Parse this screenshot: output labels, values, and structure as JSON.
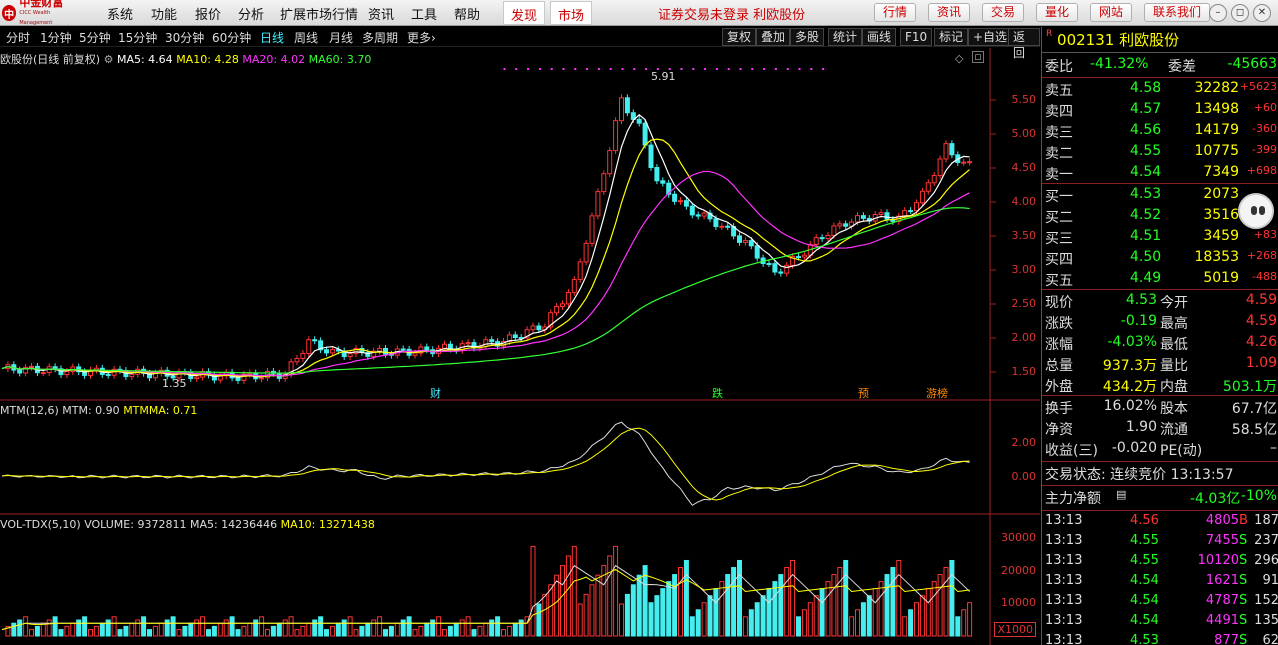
{
  "app": {
    "logo_text": "中金财富",
    "logo_sub": "CICC Wealth Management",
    "menus": [
      "系统",
      "功能",
      "报价",
      "分析",
      "扩展市场行情",
      "资讯",
      "工具",
      "帮助"
    ],
    "highlight_tabs": [
      "发现",
      "市场"
    ],
    "notice": "证券交易未登录  利欧股份",
    "right_buttons": [
      "行情",
      "资讯",
      "交易",
      "量化",
      "网站",
      "联系我们"
    ],
    "window_buttons": [
      "–",
      "◻",
      "✕"
    ]
  },
  "toolbar": {
    "periods": [
      "分时",
      "1分钟",
      "5分钟",
      "15分钟",
      "30分钟",
      "60分钟",
      "日线",
      "周线",
      "月线",
      "多周期",
      "更多"
    ],
    "active_period": "日线",
    "more_arrow": "›",
    "tools": [
      "复权",
      "叠加",
      "多股",
      "统计",
      "画线",
      "F10",
      "标记",
      "+自选",
      "返回"
    ]
  },
  "price_panel": {
    "legend_title": "欧股份(日线 前复权)",
    "ma": [
      {
        "label": "MA5: 4.64",
        "color": "#ffffff"
      },
      {
        "label": "MA10: 4.28",
        "color": "#ffff00"
      },
      {
        "label": "MA20: 4.02",
        "color": "#ff33ff"
      },
      {
        "label": "MA60: 3.70",
        "color": "#33ff33"
      }
    ],
    "high_label": "5.91",
    "low_label": "1.35",
    "y_ticks": [
      "5.50",
      "5.00",
      "4.50",
      "4.00",
      "3.50",
      "3.00",
      "2.50",
      "2.00",
      "1.50"
    ],
    "markers": [
      {
        "text": "财",
        "color": "#4ef"
      },
      {
        "text": "跌",
        "color": "#2f2"
      },
      {
        "text": "预",
        "color": "#ff8c00"
      },
      {
        "text": "游榜",
        "color": "#ff8c00"
      }
    ]
  },
  "mtm_panel": {
    "title": "MTM(12,6)",
    "mtm": "MTM: 0.90",
    "mtmma": "MTMMA: 0.71",
    "y_ticks": [
      "2.00",
      "0.00"
    ]
  },
  "vol_panel": {
    "title": "VOL-TDX(5,10)",
    "volume": "VOLUME: 9372811",
    "ma5": "MA5: 14236446",
    "ma10": "MA10: 13271438",
    "y_ticks": [
      "30000",
      "20000",
      "10000"
    ],
    "unit": "X1000"
  },
  "quote": {
    "code": "002131",
    "name": "利欧股份",
    "code_mark": "R",
    "weibi_label": "委比",
    "weibi": "-41.32%",
    "weicha_label": "委差",
    "weicha": "-45663",
    "sells": [
      {
        "label": "卖五",
        "price": "4.58",
        "vol": "32282",
        "chg": "+5623"
      },
      {
        "label": "卖四",
        "price": "4.57",
        "vol": "13498",
        "chg": "+60"
      },
      {
        "label": "卖三",
        "price": "4.56",
        "vol": "14179",
        "chg": "-360"
      },
      {
        "label": "卖二",
        "price": "4.55",
        "vol": "10775",
        "chg": "-399"
      },
      {
        "label": "卖一",
        "price": "4.54",
        "vol": "7349",
        "chg": "+698"
      }
    ],
    "buys": [
      {
        "label": "买一",
        "price": "4.53",
        "vol": "2073",
        "chg": ""
      },
      {
        "label": "买二",
        "price": "4.52",
        "vol": "3516",
        "chg": ""
      },
      {
        "label": "买三",
        "price": "4.51",
        "vol": "3459",
        "chg": "+83"
      },
      {
        "label": "买四",
        "price": "4.50",
        "vol": "18353",
        "chg": "+268"
      },
      {
        "label": "买五",
        "price": "4.49",
        "vol": "5019",
        "chg": "-488"
      }
    ],
    "stats": [
      {
        "l1": "现价",
        "v1": "4.53",
        "l2": "今开",
        "v2": "4.59"
      },
      {
        "l1": "涨跌",
        "v1": "-0.19",
        "l2": "最高",
        "v2": "4.59"
      },
      {
        "l1": "涨幅",
        "v1": "-4.03%",
        "l2": "最低",
        "v2": "4.26"
      },
      {
        "l1": "总量",
        "v1": "937.3万",
        "l2": "量比",
        "v2": "1.09"
      },
      {
        "l1": "外盘",
        "v1": "434.2万",
        "l2": "内盘",
        "v2": "503.1万"
      }
    ],
    "stats2": [
      {
        "l1": "换手",
        "v1": "16.02%",
        "l2": "股本",
        "v2": "67.7亿"
      },
      {
        "l1": "净资",
        "v1": "1.90",
        "l2": "流通",
        "v2": "58.5亿"
      },
      {
        "l1": "收益(三)",
        "v1": "-0.020",
        "l2": "PE(动)",
        "v2": "–"
      }
    ],
    "trade_status": "交易状态: 连续竞价 13:13:57",
    "main_net_label": "主力净额",
    "main_net": "-4.03亿",
    "main_net_pct": "-10%",
    "ticks": [
      {
        "t": "13:13",
        "p": "4.56",
        "v": "4805",
        "s": "B",
        "n": "187"
      },
      {
        "t": "13:13",
        "p": "4.55",
        "v": "7455",
        "s": "S",
        "n": "237"
      },
      {
        "t": "13:13",
        "p": "4.55",
        "v": "10120",
        "s": "S",
        "n": "296"
      },
      {
        "t": "13:13",
        "p": "4.54",
        "v": "1621",
        "s": "S",
        "n": "91"
      },
      {
        "t": "13:13",
        "p": "4.54",
        "v": "4787",
        "s": "S",
        "n": "152"
      },
      {
        "t": "13:13",
        "p": "4.54",
        "v": "4491",
        "s": "S",
        "n": "135"
      },
      {
        "t": "13:13",
        "p": "4.53",
        "v": "877",
        "s": "S",
        "n": "62"
      }
    ]
  },
  "colors": {
    "up": "#ff3333",
    "down": "#44eeee",
    "ma5": "#ffffff",
    "ma10": "#ffff00",
    "ma20": "#ff33ff",
    "ma60": "#33ff33"
  }
}
